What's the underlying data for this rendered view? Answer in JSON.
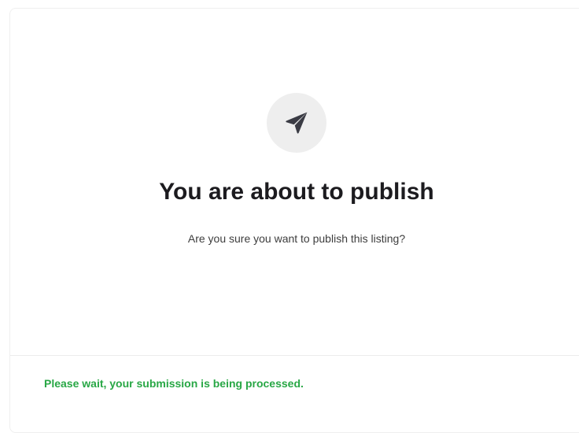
{
  "dialog": {
    "icon": "paper-plane-icon",
    "title": "You are about to publish",
    "message": "Are you sure you want to publish this listing?",
    "status": "Please wait, your submission is being processed.",
    "status_color": "#28a745"
  }
}
